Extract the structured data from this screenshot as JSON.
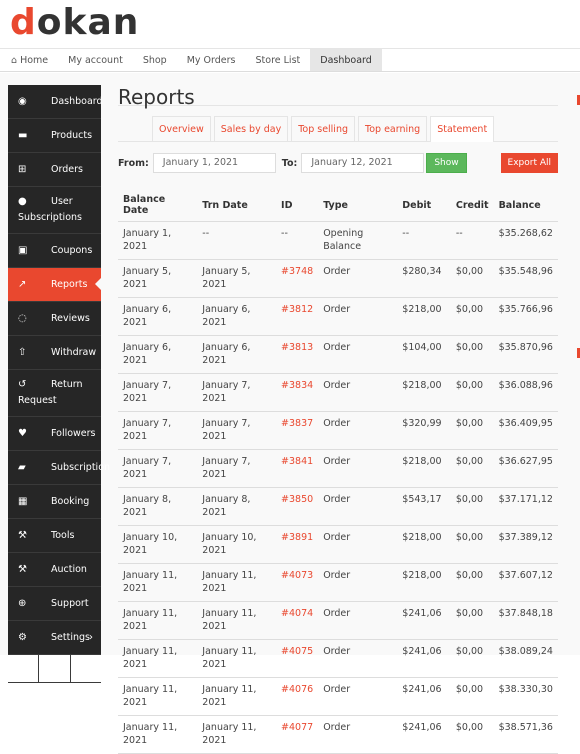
{
  "logo": {
    "first": "d",
    "rest": "okan"
  },
  "topnav": [
    {
      "icon": "home-icon",
      "label": "Home"
    },
    {
      "label": "My account"
    },
    {
      "label": "Shop"
    },
    {
      "label": "My Orders"
    },
    {
      "label": "Store List"
    },
    {
      "label": "Dashboard",
      "active": true
    }
  ],
  "sidebar": {
    "items": [
      {
        "icon": "dashboard-icon",
        "glyph": "◉",
        "label": "Dashboard"
      },
      {
        "icon": "briefcase-icon",
        "glyph": "▬",
        "label": "Products"
      },
      {
        "icon": "cart-icon",
        "glyph": "⊞",
        "label": "Orders"
      },
      {
        "icon": "users-icon",
        "glyph": "●",
        "label": "User Subscriptions"
      },
      {
        "icon": "gift-icon",
        "glyph": "▣",
        "label": "Coupons"
      },
      {
        "icon": "chart-icon",
        "glyph": "↗",
        "label": "Reports",
        "active": true
      },
      {
        "icon": "comments-icon",
        "glyph": "◌",
        "label": "Reviews"
      },
      {
        "icon": "upload-icon",
        "glyph": "⇧",
        "label": "Withdraw"
      },
      {
        "icon": "undo-icon",
        "glyph": "↺",
        "label": "Return Request"
      },
      {
        "icon": "heart-icon",
        "glyph": "♥",
        "label": "Followers"
      },
      {
        "icon": "book-icon",
        "glyph": "▰",
        "label": "Subscription"
      },
      {
        "icon": "calendar-icon",
        "glyph": "▦",
        "label": "Booking"
      },
      {
        "icon": "wrench-icon",
        "glyph": "⚒",
        "label": "Tools"
      },
      {
        "icon": "gavel-icon",
        "glyph": "⚒",
        "label": "Auction"
      },
      {
        "icon": "lifebuoy-icon",
        "glyph": "⊕",
        "label": "Support"
      },
      {
        "icon": "gear-icon",
        "glyph": "⚙",
        "label": "Settings",
        "chevron": "›"
      }
    ],
    "bottom": [
      {
        "icon": "external-link-icon",
        "glyph": "↗"
      },
      {
        "icon": "user-icon",
        "glyph": "●"
      },
      {
        "icon": "power-icon",
        "glyph": "⏻"
      }
    ]
  },
  "main": {
    "title": "Reports",
    "tabs": [
      "Overview",
      "Sales by day",
      "Top selling",
      "Top earning",
      "Statement"
    ],
    "active_tab": "Statement",
    "filters": {
      "from_label": "From:",
      "from_value": "January 1, 2021",
      "to_label": "To:",
      "to_value": "January 12, 2021",
      "show_label": "Show",
      "export_label": "Export All"
    },
    "table": {
      "headers": [
        "Balance Date",
        "Trn Date",
        "ID",
        "Type",
        "Debit",
        "Credit",
        "Balance"
      ],
      "rows": [
        [
          "January 1, 2021",
          "--",
          "--",
          "Opening Balance",
          "--",
          "--",
          "$35.268,62"
        ],
        [
          "January 5, 2021",
          "January 5, 2021",
          "#3748",
          "Order",
          "$280,34",
          "$0,00",
          "$35.548,96"
        ],
        [
          "January 6, 2021",
          "January 6, 2021",
          "#3812",
          "Order",
          "$218,00",
          "$0,00",
          "$35.766,96"
        ],
        [
          "January 6, 2021",
          "January 6, 2021",
          "#3813",
          "Order",
          "$104,00",
          "$0,00",
          "$35.870,96"
        ],
        [
          "January 7, 2021",
          "January 7, 2021",
          "#3834",
          "Order",
          "$218,00",
          "$0,00",
          "$36.088,96"
        ],
        [
          "January 7, 2021",
          "January 7, 2021",
          "#3837",
          "Order",
          "$320,99",
          "$0,00",
          "$36.409,95"
        ],
        [
          "January 7, 2021",
          "January 7, 2021",
          "#3841",
          "Order",
          "$218,00",
          "$0,00",
          "$36.627,95"
        ],
        [
          "January 8, 2021",
          "January 8, 2021",
          "#3850",
          "Order",
          "$543,17",
          "$0,00",
          "$37.171,12"
        ],
        [
          "January 10, 2021",
          "January 10, 2021",
          "#3891",
          "Order",
          "$218,00",
          "$0,00",
          "$37.389,12"
        ],
        [
          "January 11, 2021",
          "January 11, 2021",
          "#4073",
          "Order",
          "$218,00",
          "$0,00",
          "$37.607,12"
        ],
        [
          "January 11, 2021",
          "January 11, 2021",
          "#4074",
          "Order",
          "$241,06",
          "$0,00",
          "$37.848,18"
        ],
        [
          "January 11, 2021",
          "January 11, 2021",
          "#4075",
          "Order",
          "$241,06",
          "$0,00",
          "$38.089,24"
        ],
        [
          "January 11, 2021",
          "January 11, 2021",
          "#4076",
          "Order",
          "$241,06",
          "$0,00",
          "$38.330,30"
        ],
        [
          "January 11, 2021",
          "January 11, 2021",
          "#4077",
          "Order",
          "$241,06",
          "$0,00",
          "$38.571,36"
        ]
      ]
    }
  },
  "colors": {
    "accent": "#e9482f",
    "success": "#5cb85c",
    "sidebar": "#262626"
  }
}
